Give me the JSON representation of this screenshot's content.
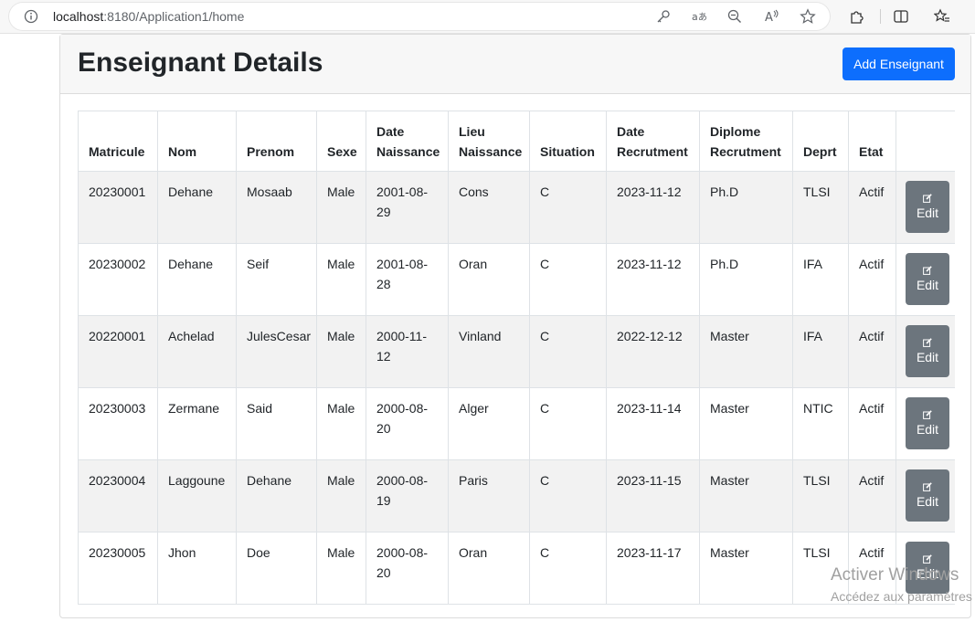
{
  "browser": {
    "url_host": "localhost",
    "url_rest": ":8180/Application1/home"
  },
  "header": {
    "title": "Enseignant Details",
    "add_button": "Add Enseignant"
  },
  "table": {
    "columns": [
      [
        "",
        "Matricule"
      ],
      [
        "",
        "Nom"
      ],
      [
        "",
        "Prenom"
      ],
      [
        "",
        "Sexe"
      ],
      [
        "Date",
        "Naissance"
      ],
      [
        "Lieu",
        "Naissance"
      ],
      [
        "",
        "Situation"
      ],
      [
        "Date",
        "Recrutment"
      ],
      [
        "Diplome",
        "Recrutment"
      ],
      [
        "",
        "Deprt"
      ],
      [
        "",
        "Etat"
      ],
      [
        "",
        ""
      ]
    ],
    "rows": [
      {
        "cells": [
          "20230001",
          "Dehane",
          "Mosaab",
          "Male",
          "2001-08-29",
          "Cons",
          "C",
          "2023-11-12",
          "Ph.D",
          "TLSI",
          "Actif"
        ]
      },
      {
        "cells": [
          "20230002",
          "Dehane",
          "Seif",
          "Male",
          "2001-08-28",
          "Oran",
          "C",
          "2023-11-12",
          "Ph.D",
          "IFA",
          "Actif"
        ]
      },
      {
        "cells": [
          "20220001",
          "Achelad",
          "JulesCesar",
          "Male",
          "2000-11-12",
          "Vinland",
          "C",
          "2022-12-12",
          "Master",
          "IFA",
          "Actif"
        ]
      },
      {
        "cells": [
          "20230003",
          "Zermane",
          "Said",
          "Male",
          "2000-08-20",
          "Alger",
          "C",
          "2023-11-14",
          "Master",
          "NTIC",
          "Actif"
        ]
      },
      {
        "cells": [
          "20230004",
          "Laggoune",
          "Dehane",
          "Male",
          "2000-08-19",
          "Paris",
          "C",
          "2023-11-15",
          "Master",
          "TLSI",
          "Actif"
        ]
      },
      {
        "cells": [
          "20230005",
          "Jhon",
          "Doe",
          "Male",
          "2000-08-20",
          "Oran",
          "C",
          "2023-11-17",
          "Master",
          "TLSI",
          "Actif"
        ]
      }
    ],
    "edit_label": "Edit"
  },
  "watermark": {
    "line1": "Activer Windows",
    "line2": "Accédez aux paramètres"
  },
  "colors": {
    "primary": "#0d6efd",
    "secondary": "#6c757d"
  },
  "icons": [
    "info-icon",
    "key-icon",
    "read-aloud-icon",
    "zoom-out-icon",
    "text-size-icon",
    "star-icon",
    "extensions-icon",
    "split-screen-icon",
    "favorites-icon",
    "edit-icon"
  ]
}
